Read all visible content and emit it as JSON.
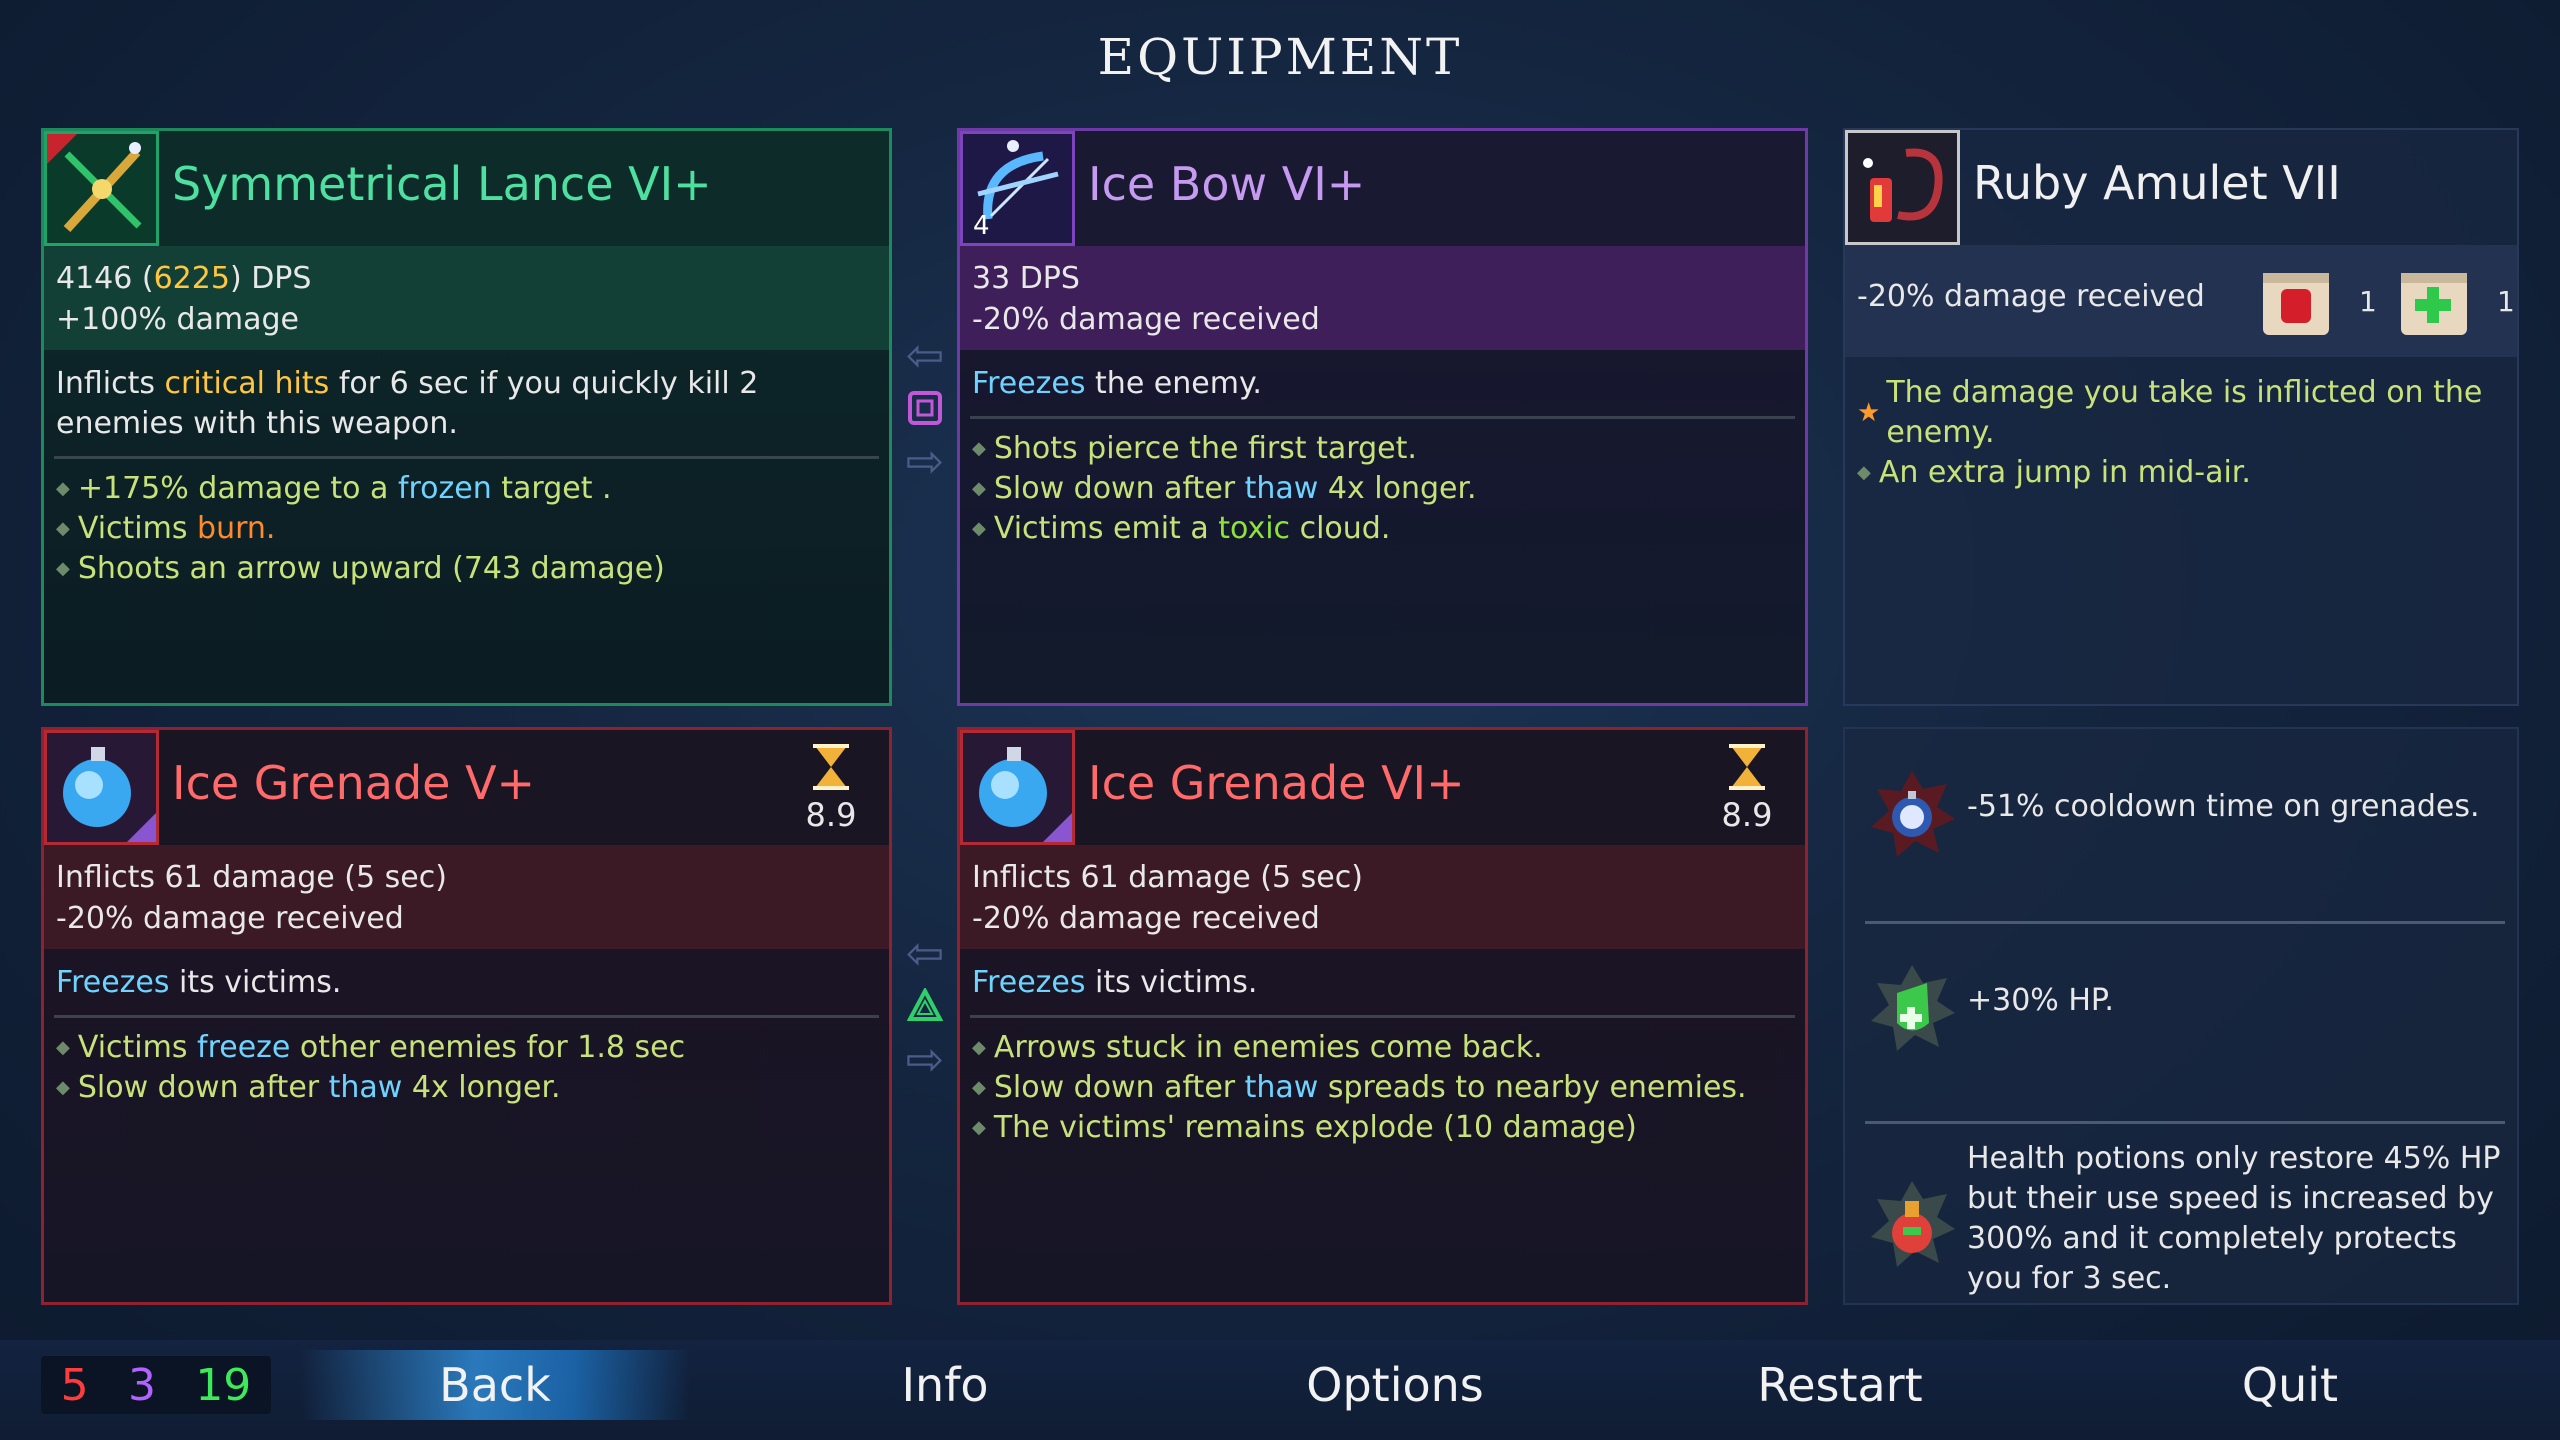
{
  "title": "EQUIPMENT",
  "weapons": {
    "lance": {
      "name": "Symmetrical Lance VI+",
      "stat_dps_prefix": "4146 (",
      "stat_dps_boost": "6225",
      "stat_dps_suffix": ") DPS",
      "stat_2": "+100% damage",
      "desc_1": "Inflicts ",
      "desc_kw": "critical hits",
      "desc_2": " for 6 sec if you quickly kill 2 enemies with this weapon.",
      "b1_a": "+175% damage to a ",
      "b1_kw": "frozen",
      "b1_b": " target .",
      "b2_a": "Victims ",
      "b2_kw": "burn.",
      "b3": "Shoots an arrow upward (743 damage)"
    },
    "bow": {
      "name": "Ice Bow VI+",
      "icon_count": "4",
      "stat_1": "33 DPS",
      "stat_2": "-20% damage received",
      "desc_kw": "Freezes",
      "desc_2": " the enemy.",
      "b1": "Shots pierce the first target.",
      "b2_a": "Slow down after ",
      "b2_kw": "thaw",
      "b2_b": " 4x longer.",
      "b3_a": "Victims emit a ",
      "b3_kw": "toxic",
      "b3_b": " cloud."
    }
  },
  "skills": {
    "grenade1": {
      "name": "Ice Grenade V+",
      "cooldown": "8.9",
      "stat_1": "Inflicts 61 damage (5 sec)",
      "stat_2": "-20% damage received",
      "desc_kw": "Freezes",
      "desc_2": " its victims.",
      "b1_a": "Victims ",
      "b1_kw": "freeze",
      "b1_b": " other enemies for 1.8 sec",
      "b2_a": "Slow down after ",
      "b2_kw": "thaw",
      "b2_b": " 4x longer."
    },
    "grenade2": {
      "name": "Ice Grenade VI+",
      "cooldown": "8.9",
      "stat_1": "Inflicts 61 damage (5 sec)",
      "stat_2": "-20% damage received",
      "desc_kw": "Freezes",
      "desc_2": " its victims.",
      "b1": "Arrows stuck in enemies come back.",
      "b2_a": "Slow down after ",
      "b2_kw": "thaw",
      "b2_b": " spreads to nearby enemies.",
      "b3": "The victims' remains explode (10 damage)"
    }
  },
  "amulet": {
    "name": "Ruby Amulet VII",
    "stat": "-20% damage received",
    "scroll_brutality_count": "1",
    "scroll_survival_count": "1",
    "b1": "The damage you take is inflicted on the enemy.",
    "b2": "An extra jump in mid-air."
  },
  "mutations": [
    {
      "text": "-51% cooldown time on grenades."
    },
    {
      "text": "+30% HP."
    },
    {
      "text": "Health potions only restore 45% HP but their use speed is increased by 300% and it completely protects you for 3 sec."
    }
  ],
  "counters": {
    "brutality": "5",
    "tactics": "3",
    "survival": "19"
  },
  "menu": {
    "back": "Back",
    "info": "Info",
    "options": "Options",
    "restart": "Restart",
    "quit": "Quit"
  }
}
